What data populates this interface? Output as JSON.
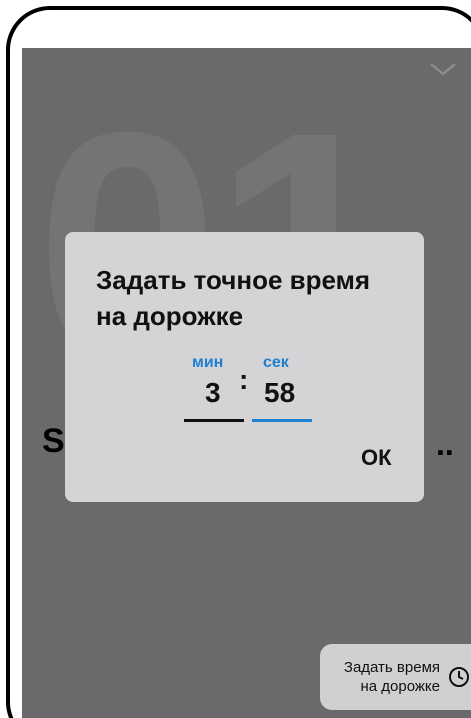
{
  "background": {
    "big_number": "01",
    "heading_start": "Se",
    "heading_ellipsis": "..",
    "set_time_button_label": "Задать время на дорожке",
    "chevron_icon": "chevron-down-icon",
    "clock_icon": "clock-icon"
  },
  "dialog": {
    "title": "Задать точное время на дорожке",
    "minutes_label": "мин",
    "seconds_label": "сек",
    "minutes_value": "3",
    "separator": ":",
    "seconds_value": "58",
    "ok_label": "ОК"
  },
  "colors": {
    "accent": "#1f7fd1",
    "overlay": "#6a6a6c",
    "dialog_bg": "#d4d4d6"
  }
}
